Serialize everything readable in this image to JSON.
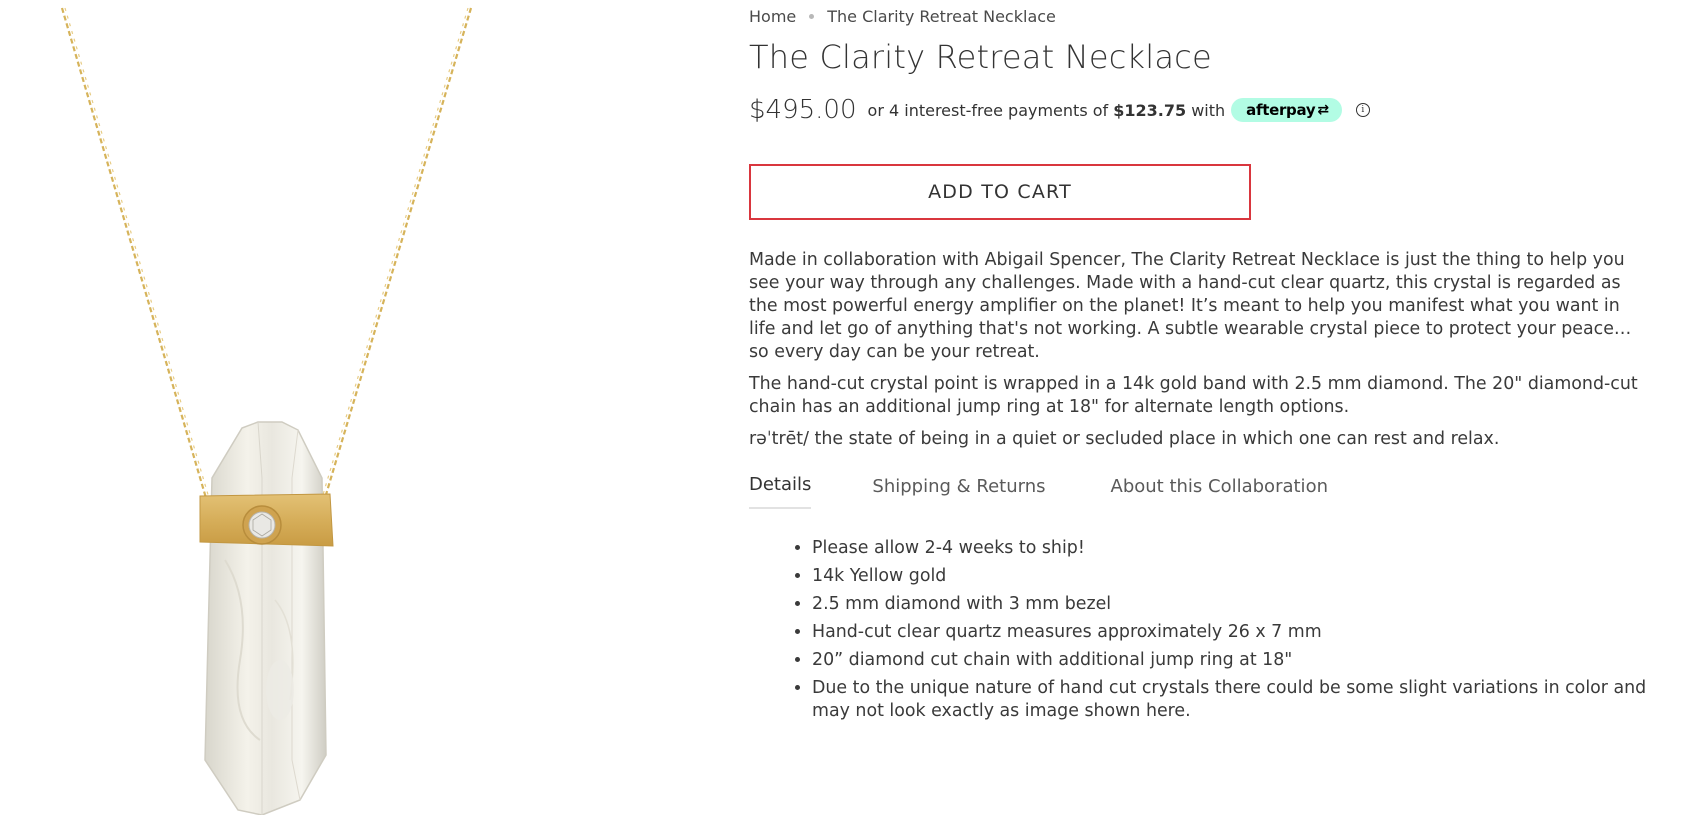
{
  "breadcrumb": {
    "home": "Home",
    "current": "The Clarity Retreat Necklace"
  },
  "product": {
    "title": "The Clarity Retreat Necklace",
    "price": "$495.00",
    "image_alt": "clear-quartz-crystal-necklace"
  },
  "afterpay": {
    "prefix": "or 4 interest-free payments of",
    "amount": "$123.75",
    "suffix": "with",
    "brand": "afterpay",
    "brand_color": "#b2fce4",
    "info_icon": "i"
  },
  "cart": {
    "button_label": "ADD TO CART",
    "border_color": "#d9363e"
  },
  "description": {
    "paragraph_1": "Made in collaboration with Abigail Spencer, The Clarity Retreat Necklace is just the thing to help you see your way through any challenges. Made with a hand-cut clear quartz, this crystal is regarded as the most powerful energy amplifier on the planet! It’s meant to help you manifest what you want in life and let go of anything that's not working. A subtle wearable crystal piece to protect your peace…so every day can be your retreat.",
    "paragraph_2": "The hand-cut crystal point is wrapped in a 14k gold band with 2.5 mm diamond. The 20\" diamond-cut chain has an additional jump ring at 18\" for alternate length options.",
    "paragraph_3": "rəˈtrēt/ the state of being in a quiet or secluded place in which one can rest and relax."
  },
  "tabs": [
    {
      "label": "Details",
      "active": true
    },
    {
      "label": "Shipping & Returns",
      "active": false
    },
    {
      "label": "About this Collaboration",
      "active": false
    }
  ],
  "details": [
    "Please allow 2-4 weeks to ship!",
    "14k Yellow gold",
    "2.5 mm diamond with 3 mm bezel",
    "Hand-cut clear quartz measures approximately 26 x 7 mm",
    "20” diamond cut chain with additional jump ring at 18\"",
    "Due to the unique nature of hand cut crystals there could be some slight variations in color and may not look exactly as image shown here."
  ]
}
